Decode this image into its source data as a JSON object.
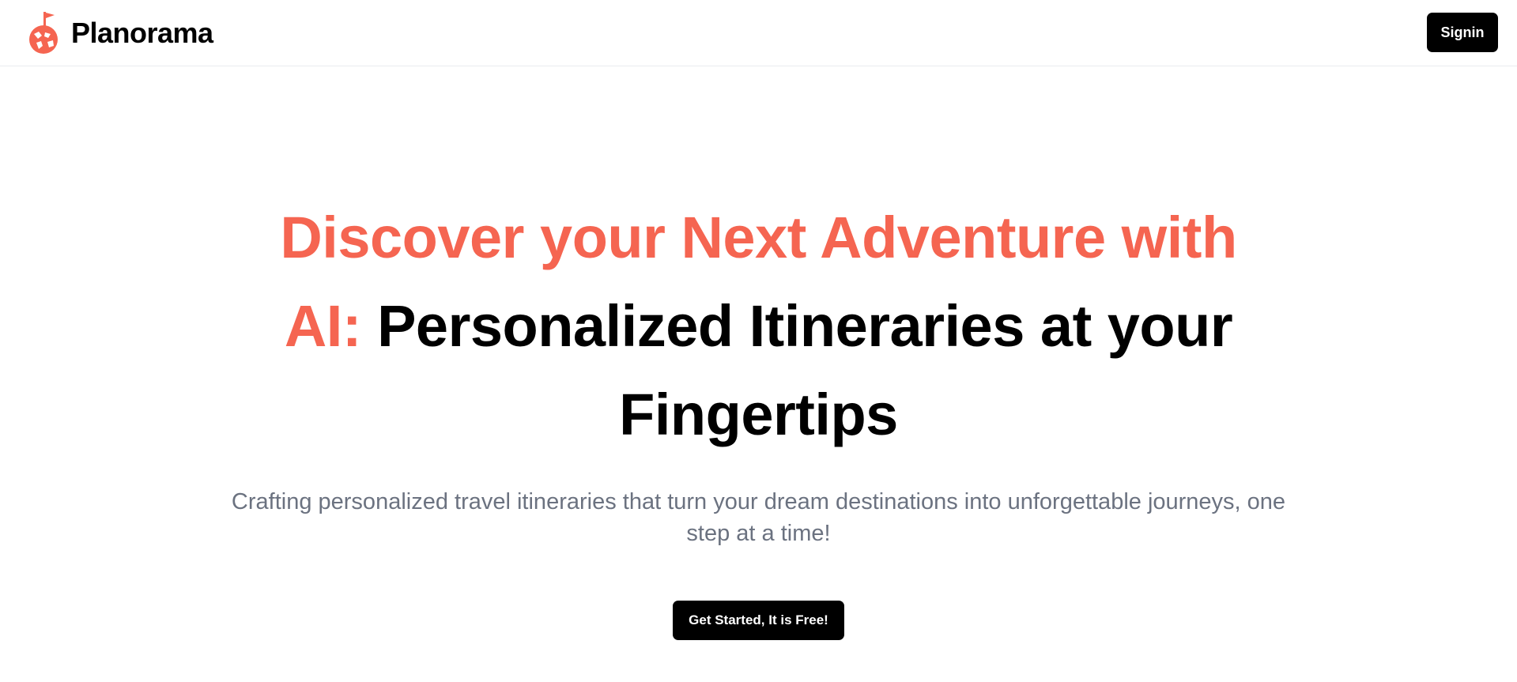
{
  "header": {
    "logo_icon": "globe-with-flag-icon",
    "brand_name": "Planorama",
    "signin_label": "Signin"
  },
  "hero": {
    "headline_accent": "Discover your Next Adventure with AI:",
    "headline_rest": "Personalized Itineraries at your Fingertips",
    "subtitle": "Crafting personalized travel itineraries that turn your dream destinations into unforgettable journeys, one step at a time!",
    "cta_label": "Get Started, It is Free!"
  },
  "colors": {
    "accent": "#f56551",
    "button_bg": "#000000",
    "button_text": "#ffffff",
    "subtitle_text": "#6b7280"
  }
}
